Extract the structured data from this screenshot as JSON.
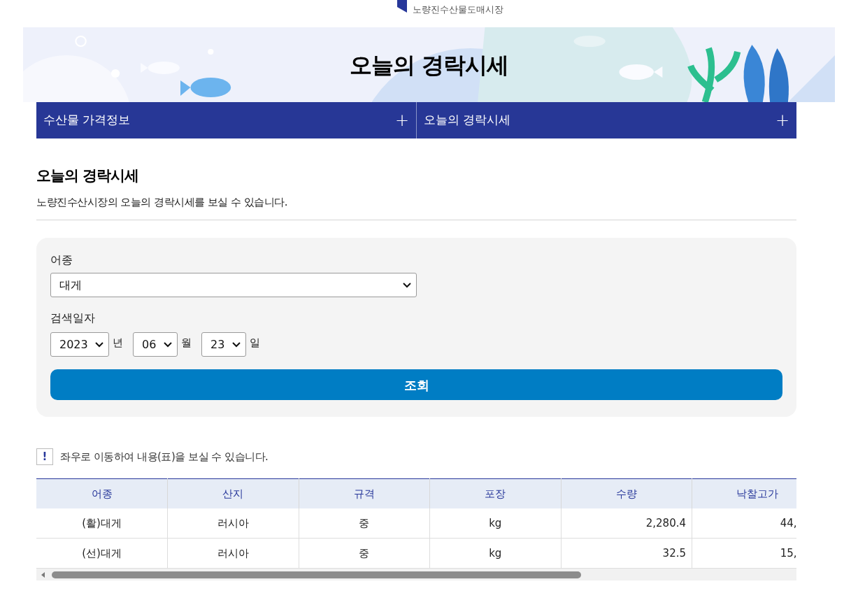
{
  "logo": {
    "text": "노량진수산물도매시장"
  },
  "banner": {
    "title": "오늘의 경락시세"
  },
  "nav": [
    {
      "label": "수산물 가격정보",
      "icon": "+"
    },
    {
      "label": "오늘의 경락시세",
      "icon": "+"
    }
  ],
  "section": {
    "title": "오늘의 경락시세",
    "description": "노량진수산시장의 오늘의 경락시세를 보실 수 있습니다."
  },
  "search": {
    "species_label": "어종",
    "species_value": "대게",
    "date_label": "검색일자",
    "date_parts": [
      {
        "value": "2023",
        "unit": "년"
      },
      {
        "value": "06",
        "unit": "월"
      },
      {
        "value": "23",
        "unit": "일"
      }
    ],
    "submit": "조회"
  },
  "notice": {
    "icon": "!",
    "text": "좌우로 이동하여 내용(표)을 보실 수 있습니다."
  },
  "table": {
    "columns": [
      "어종",
      "산지",
      "규격",
      "포장",
      "수량",
      "낙찰고가"
    ],
    "rows": [
      [
        "(활)대게",
        "러시아",
        "중",
        "kg",
        "2,280.4",
        "44,"
      ],
      [
        "(선)대게",
        "러시아",
        "중",
        "kg",
        "32.5",
        "15,"
      ]
    ]
  }
}
